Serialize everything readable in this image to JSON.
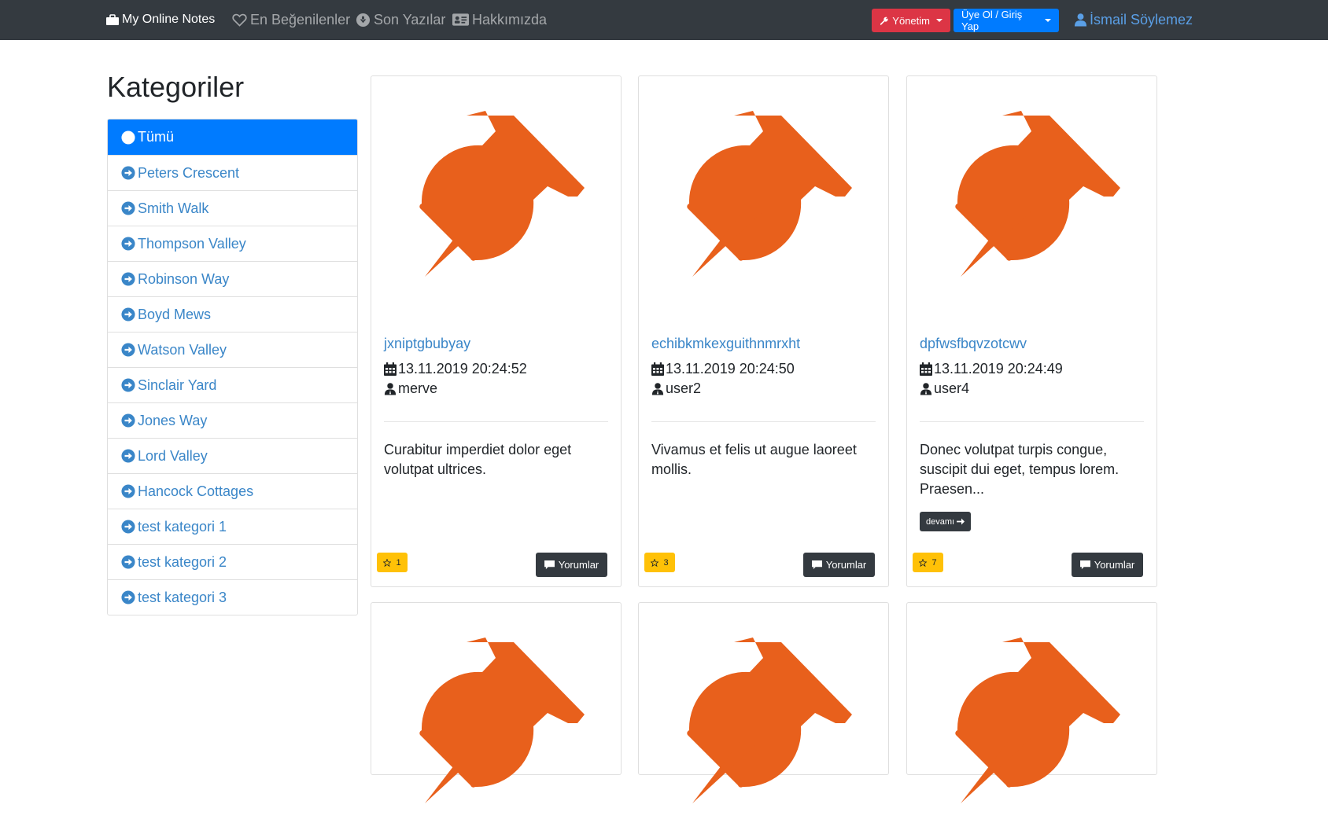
{
  "navbar": {
    "brand": "My Online Notes",
    "favorites": "En Beğenilenler",
    "latest": "Son Yazılar",
    "about": "Hakkımızda",
    "admin": "Yönetim",
    "login": "Üye Ol / Giriş Yap",
    "user": "İsmail Söylemez"
  },
  "sidebar": {
    "title": "Kategoriler",
    "items": [
      {
        "label": "Tümü",
        "active": true
      },
      {
        "label": "Peters Crescent"
      },
      {
        "label": "Smith Walk"
      },
      {
        "label": "Thompson Valley"
      },
      {
        "label": "Robinson Way"
      },
      {
        "label": "Boyd Mews"
      },
      {
        "label": "Watson Valley"
      },
      {
        "label": "Sinclair Yard"
      },
      {
        "label": "Jones Way"
      },
      {
        "label": "Lord Valley"
      },
      {
        "label": "Hancock Cottages"
      },
      {
        "label": "test kategori 1"
      },
      {
        "label": "test kategori 2"
      },
      {
        "label": "test kategori 3"
      }
    ]
  },
  "cards": [
    {
      "title": "jxniptgbubyay",
      "date": "13.11.2019 20:24:52",
      "author": "merve",
      "text": "Curabitur imperdiet dolor eget volutpat ultrices.",
      "likes": "1",
      "comments_label": "Yorumlar"
    },
    {
      "title": "echibkmkexguithnmrxht",
      "date": "13.11.2019 20:24:50",
      "author": "user2",
      "text": "Vivamus et felis ut augue laoreet mollis.",
      "likes": "3",
      "comments_label": "Yorumlar"
    },
    {
      "title": "dpfwsfbqvzotcwv",
      "date": "13.11.2019 20:24:49",
      "author": "user4",
      "text": "Donec volutpat turpis congue, suscipit dui eget, tempus lorem. Praesen...",
      "more_label": "devamı",
      "likes": "7",
      "comments_label": "Yorumlar"
    }
  ],
  "colors": {
    "navbar_bg": "#343a40",
    "primary": "#007bff",
    "danger": "#dc3545",
    "warning": "#ffc107",
    "pin": "#e8601c",
    "link": "#3a86c8"
  },
  "icons": {
    "brand": "briefcase-icon",
    "favorites": "heart-icon",
    "latest": "arrow-circle-down-icon",
    "about": "id-card-icon",
    "admin": "wrench-icon",
    "user": "user-icon",
    "category": "arrow-circle-right-icon",
    "date": "calendar-icon",
    "author": "user-icon",
    "likes": "star-icon",
    "comments": "comment-icon",
    "card_image": "pushpin-icon"
  }
}
